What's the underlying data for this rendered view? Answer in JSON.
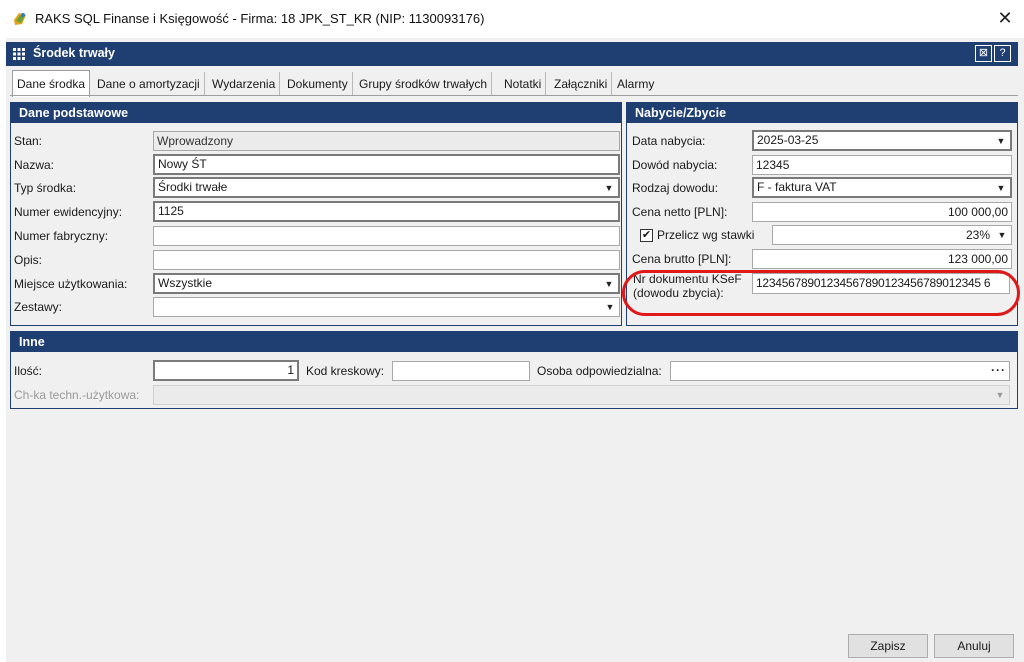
{
  "window": {
    "title": "RAKS SQL Finanse i Księgowość - Firma: 18 JPK_ST_KR (NIP: 1130093176)"
  },
  "form": {
    "title": "Środek trwały",
    "header_buttons": [
      "⊠",
      "?"
    ]
  },
  "tabs": [
    {
      "label": "Dane środka",
      "active": true
    },
    {
      "label": "Dane o amortyzacji",
      "active": false
    },
    {
      "label": "Wydarzenia",
      "active": false
    },
    {
      "label": "Dokumenty",
      "active": false
    },
    {
      "label": "Grupy środków trwałych",
      "active": false
    },
    {
      "label": "Notatki",
      "active": false
    },
    {
      "label": "Załączniki",
      "active": false
    },
    {
      "label": "Alarmy",
      "active": false
    }
  ],
  "basic": {
    "header": "Dane podstawowe",
    "stan_label": "Stan:",
    "stan_value": "Wprowadzony",
    "nazwa_label": "Nazwa:",
    "nazwa_value": "Nowy ŚT",
    "typ_label": "Typ środka:",
    "typ_value": "Środki trwałe",
    "numer_ew_label": "Numer ewidencyjny:",
    "numer_ew_value": "1125",
    "numer_fab_label": "Numer fabryczny:",
    "numer_fab_value": "",
    "opis_label": "Opis:",
    "opis_value": "",
    "miejsce_label": "Miejsce użytkowania:",
    "miejsce_value": "Wszystkie",
    "zestawy_label": "Zestawy:",
    "zestawy_value": ""
  },
  "purchase": {
    "header": "Nabycie/Zbycie",
    "data_label": "Data nabycia:",
    "data_value": "2025-03-25",
    "dowod_label": "Dowód nabycia:",
    "dowod_value": "12345",
    "rodzaj_label": "Rodzaj dowodu:",
    "rodzaj_value": "F - faktura VAT",
    "netto_label": "Cena netto [PLN]:",
    "netto_value": "100 000,00",
    "przelicz_label": "Przelicz wg stawki",
    "przelicz_checked": true,
    "stawka_value": "23%",
    "brutto_label": "Cena brutto [PLN]:",
    "brutto_value": "123 000,00",
    "ksef_label_line1": "Nr dokumentu KSeF",
    "ksef_label_line2": "(dowodu zbycia):",
    "ksef_value": "12345678901234567890123456789012345 6"
  },
  "other": {
    "header": "Inne",
    "ilosc_label": "Ilość:",
    "ilosc_value": "1",
    "kod_label": "Kod kreskowy:",
    "kod_value": "",
    "osoba_label": "Osoba odpowiedzialna:",
    "osoba_value": "",
    "chka_label": "Ch-ka techn.-użytkowa:",
    "chka_value": ""
  },
  "buttons": {
    "save": "Zapisz",
    "cancel": "Anuluj"
  },
  "colors": {
    "header_blue": "#1f3f73",
    "highlight_red": "#e01818"
  }
}
